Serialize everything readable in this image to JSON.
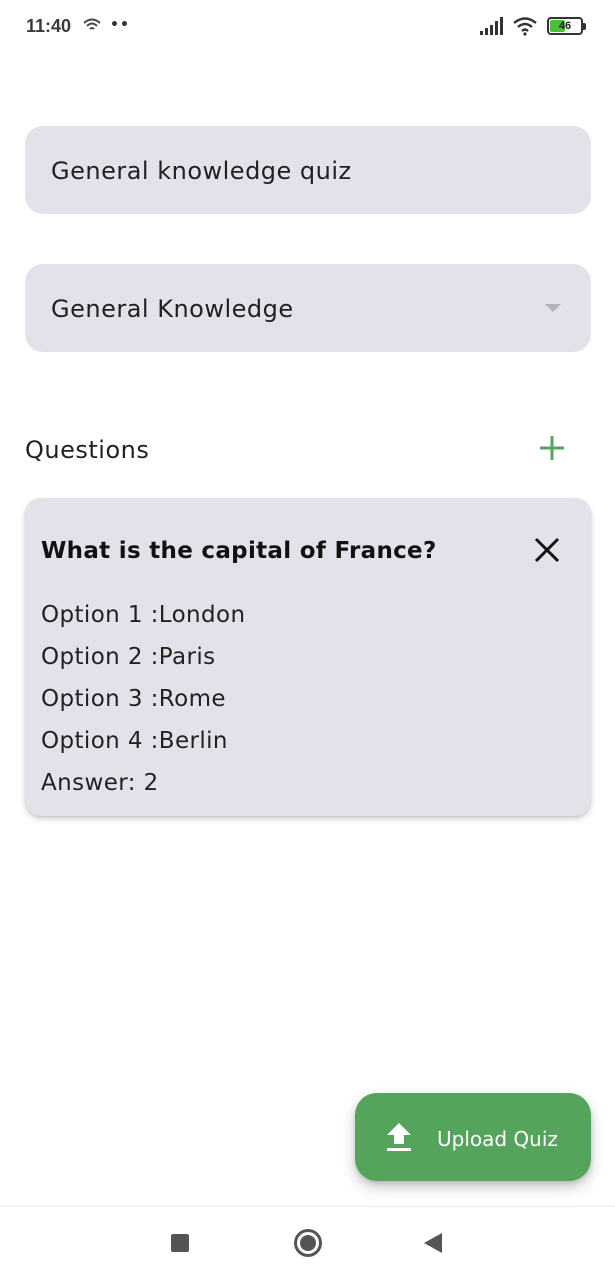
{
  "status_bar": {
    "time": "11:40",
    "battery_level": "46",
    "left_icons": [
      "wifi-icon",
      "more-dots-icon"
    ],
    "right_icons": [
      "signal-icon",
      "wifi-icon",
      "battery-icon"
    ]
  },
  "form": {
    "quiz_title_value": "General knowledge quiz",
    "category_selected": "General Knowledge"
  },
  "questions_section": {
    "label": "Questions",
    "add_icon": "plus-icon"
  },
  "questions": [
    {
      "question": "What is the capital of France?",
      "options": [
        "Option 1 :London",
        "Option 2 :Paris",
        "Option 3 :Rome",
        "Option 4 :Berlin"
      ],
      "answer": "Answer: 2"
    }
  ],
  "fab": {
    "label": "Upload Quiz",
    "icon": "upload-icon"
  },
  "nav_bar": {
    "icons": [
      "recent-apps-icon",
      "home-icon",
      "back-icon"
    ]
  },
  "colors": {
    "accent": "#54a45c",
    "field_bg": "#e2e2ea",
    "battery": "#4cbe3a"
  }
}
